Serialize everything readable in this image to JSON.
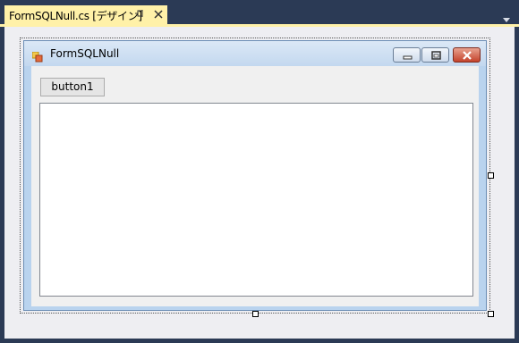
{
  "document_tab": {
    "title": "FormSQLNull.cs [デザイン]",
    "pin_glyph": "⊣⊢",
    "accent_color": "#fff1a8"
  },
  "form": {
    "title": "FormSQLNull",
    "caption_buttons": [
      "minimize",
      "maximize",
      "close"
    ]
  },
  "controls": {
    "button1_label": "button1"
  },
  "icons": [
    "pin-icon",
    "close-icon",
    "dropdown-arrow-icon",
    "form-icon",
    "minimize-icon",
    "maximize-icon",
    "close-icon"
  ]
}
